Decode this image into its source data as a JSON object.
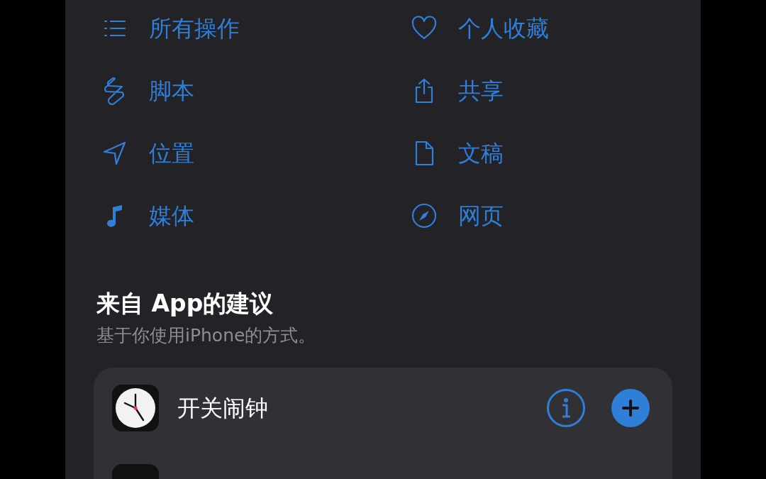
{
  "categories": [
    {
      "label": "所有操作"
    },
    {
      "label": "个人收藏"
    },
    {
      "label": "脚本"
    },
    {
      "label": "共享"
    },
    {
      "label": "位置"
    },
    {
      "label": "文稿"
    },
    {
      "label": "媒体"
    },
    {
      "label": "网页"
    }
  ],
  "suggestions": {
    "title": "来自 App的建议",
    "subtitle": "基于你使用iPhone的方式。",
    "items": [
      {
        "label": "开关闹钟"
      }
    ]
  }
}
